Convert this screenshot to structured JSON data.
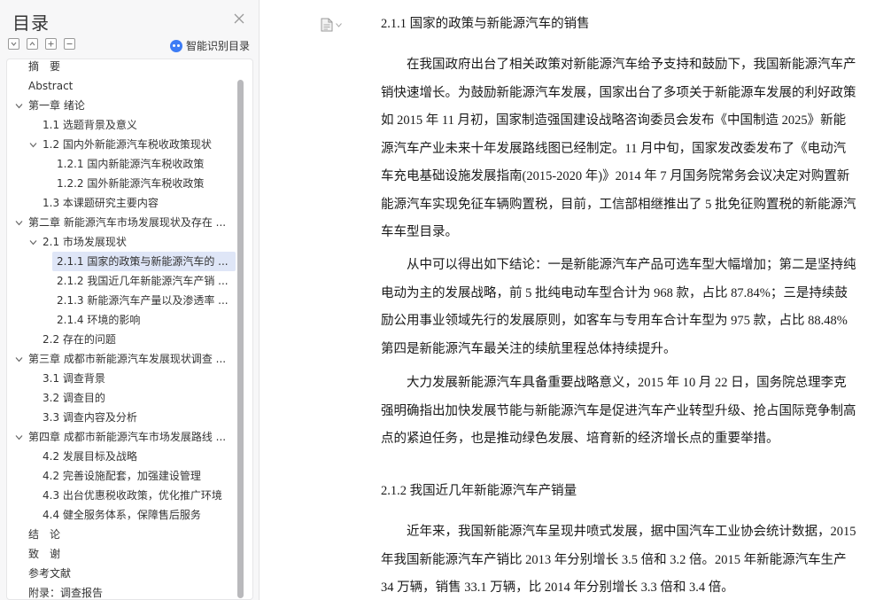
{
  "sidebar": {
    "title": "目录",
    "close_icon": "close-icon",
    "tools": [
      "expand-all-icon",
      "collapse-all-icon",
      "add-heading-icon",
      "remove-heading-icon"
    ],
    "smart_label": "智能识别目录",
    "items": [
      {
        "label": "摘　要",
        "level": 0
      },
      {
        "label": "Abstract",
        "level": 0
      },
      {
        "label": "第一章 绪论",
        "level": 0,
        "expanded": true
      },
      {
        "label": "1.1 选题背景及意义",
        "level": 1
      },
      {
        "label": "1.2 国内外新能源汽车税收政策现状",
        "level": 1,
        "expanded": true
      },
      {
        "label": "1.2.1 国内新能源汽车税收政策",
        "level": 2
      },
      {
        "label": "1.2.2 国外新能源汽车税收政策",
        "level": 2
      },
      {
        "label": "1.3 本课题研究主要内容",
        "level": 1
      },
      {
        "label": "第二章 新能源汽车市场发展现状及存在 ...",
        "level": 0,
        "expanded": true
      },
      {
        "label": "2.1 市场发展现状",
        "level": 1,
        "expanded": true
      },
      {
        "label": "2.1.1 国家的政策与新能源汽车的 ...",
        "level": 2,
        "active": true
      },
      {
        "label": "2.1.2  我国近几年新能源汽车产销 ...",
        "level": 2
      },
      {
        "label": "2.1.3 新能源汽车产量以及渗透率 ...",
        "level": 2
      },
      {
        "label": "2.1.4  环境的影响",
        "level": 2
      },
      {
        "label": "2.2 存在的问题",
        "level": 1
      },
      {
        "label": "第三章 成都市新能源汽车发展现状调查 ...",
        "level": 0,
        "expanded": true
      },
      {
        "label": "3.1 调查背景",
        "level": 1
      },
      {
        "label": "3.2 调查目的",
        "level": 1
      },
      {
        "label": "3.3 调查内容及分析",
        "level": 1
      },
      {
        "label": "第四章 成都市新能源汽车市场发展路线 ...",
        "level": 0,
        "expanded": true
      },
      {
        "label": "4.2 发展目标及战略",
        "level": 1
      },
      {
        "label": "4.2 完善设施配套，加强建设管理",
        "level": 1
      },
      {
        "label": "4.3 出台优惠税收政策，优化推广环境",
        "level": 1
      },
      {
        "label": "4.4 健全服务体系，保障售后服务",
        "level": 1
      },
      {
        "label": "结　论",
        "level": 0
      },
      {
        "label": "致　谢",
        "level": 0
      },
      {
        "label": "参考文献",
        "level": 0
      },
      {
        "label": "附录：调查报告",
        "level": 0
      }
    ]
  },
  "doc": {
    "page_icon": "document-page-icon",
    "heading1": "2.1.1 国家的政策与新能源汽车的销售",
    "p1": [
      "　　在我国政府出台了相关政策对新能源汽车给予支持和鼓励下，我国新能源汽车产",
      "销快速增长。为鼓励新能源汽车发展，国家出台了多项关于新能源车发展的利好政策",
      "如 2015 年 11 月初，国家制造强国建设战略咨询委员会发布《中国制造 2025》新能",
      "源汽车产业未来十年发展路线图已经制定。11 月中旬，国家发改委发布了《电动汽",
      "车充电基础设施发展指南(2015-2020 年)》2014 年 7 月国务院常务会议决定对购置新",
      "能源汽车实现免征车辆购置税，目前，工信部相继推出了 5 批免征购置税的新能源汽",
      "车车型目录。"
    ],
    "p2": [
      "　　从中可以得出如下结论：一是新能源汽车产品可选车型大幅增加；第二是坚持纯",
      "电动为主的发展战略，前 5 批纯电动车型合计为 968 款，占比 87.84%；三是持续鼓",
      "励公用事业领域先行的发展原则，如客车与专用车合计车型为 975 款，占比 88.48%",
      "第四是新能源汽车最关注的续航里程总体持续提升。"
    ],
    "p3": [
      "　　大力发展新能源汽车具备重要战略意义，2015 年 10 月 22 日，国务院总理李克",
      "强明确指出加快发展节能与新能源汽车是促进汽车产业转型升级、抢占国际竞争制高",
      "点的紧迫任务，也是推动绿色发展、培育新的经济增长点的重要举措。"
    ],
    "heading2": "2.1.2  我国近几年新能源汽车产销量",
    "p4": [
      "　　近年来，我国新能源汽车呈现井喷式发展，据中国汽车工业协会统计数据，2015",
      "年我国新能源汽车产销比 2013 年分别增长 3.5 倍和 3.2 倍。2015 年新能源汽车生产",
      "34 万辆，销售 33.1 万辆，比 2014 年分别增长 3.3 倍和 3.4 倍。"
    ]
  }
}
